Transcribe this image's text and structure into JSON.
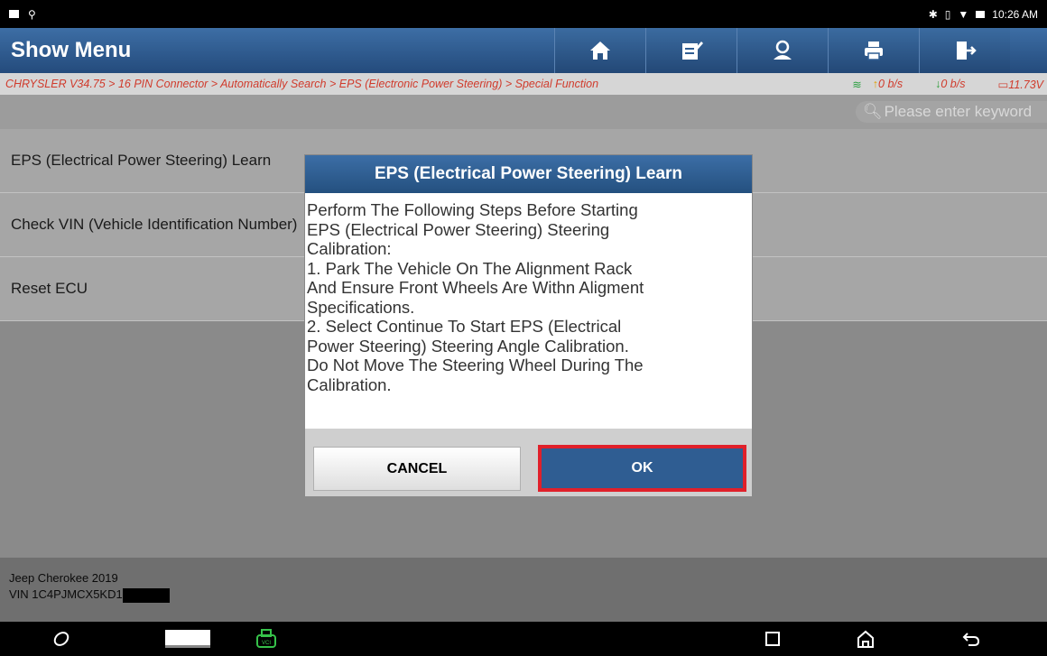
{
  "status_bar": {
    "time": "10:26 AM"
  },
  "header": {
    "title": "Show Menu",
    "buttons": [
      "home-icon",
      "edit-icon",
      "user-support-icon",
      "print-icon",
      "exit-icon"
    ]
  },
  "breadcrumb": {
    "path": "CHRYSLER V34.75 > 16 PIN Connector > Automatically Search > EPS (Electronic Power Steering) > Special Function",
    "upload": "0 b/s",
    "download": "0 b/s",
    "voltage": "11.73V"
  },
  "search": {
    "placeholder": "Please enter keyword"
  },
  "menu": {
    "items": [
      {
        "label": "EPS (Electrical Power Steering) Learn"
      },
      {
        "label": "Check VIN (Vehicle Identification Number)"
      },
      {
        "label": "Reset ECU"
      }
    ]
  },
  "footer": {
    "vehicle": "Jeep Cherokee 2019",
    "vin": "VIN 1C4PJMCX5KD1"
  },
  "dialog": {
    "title": "EPS (Electrical Power Steering) Learn",
    "lines": [
      "Perform The Following Steps Before Starting",
      "EPS (Electrical Power Steering) Steering",
      "Calibration:",
      "1. Park The Vehicle On The Alignment Rack",
      "And Ensure Front Wheels Are Withn Aligment",
      "Specifications.",
      "2. Select Continue To Start EPS (Electrical",
      "Power Steering) Steering Angle Calibration.",
      "Do Not Move The Steering Wheel During The",
      "Calibration."
    ],
    "cancel_label": "CANCEL",
    "ok_label": "OK"
  },
  "colors": {
    "header_blue": "#2f5d92",
    "breadcrumb_red": "#d03b2c",
    "ok_highlight": "#e0202a"
  }
}
